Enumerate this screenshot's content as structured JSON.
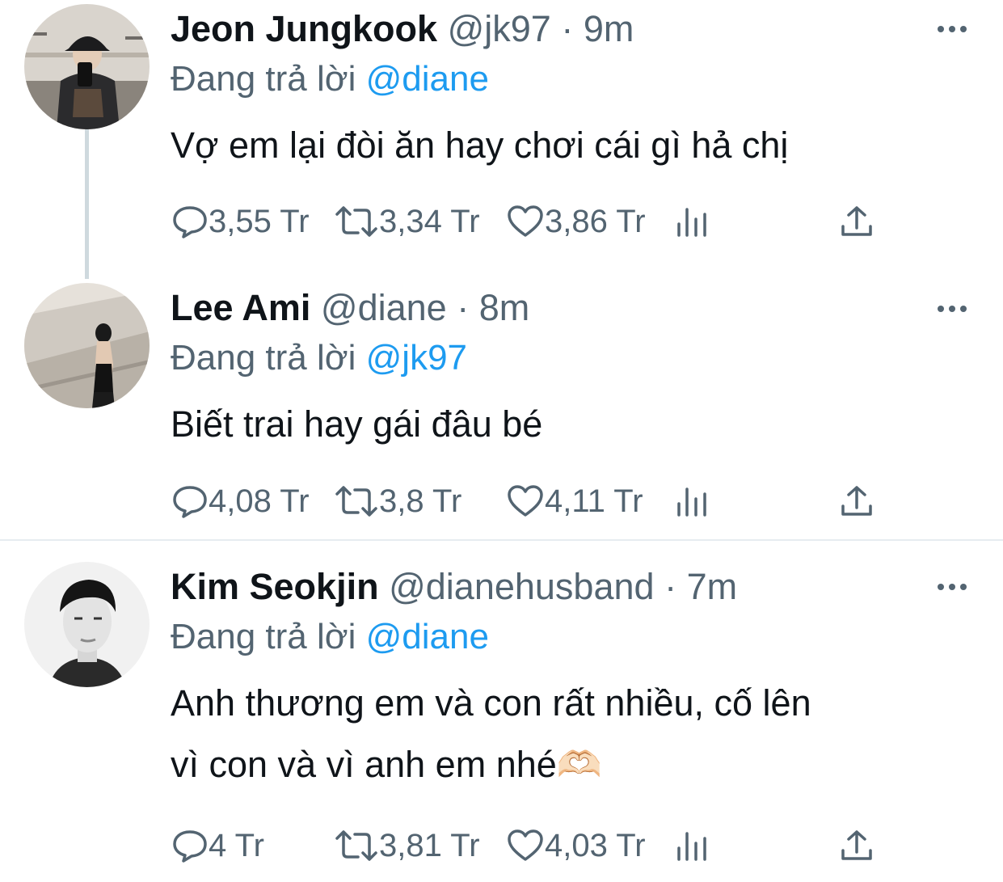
{
  "tweets": [
    {
      "name": "Jeon Jungkook",
      "handle": "@jk97",
      "dot": "·",
      "time": "9m",
      "reply_prefix": "Đang trả lời",
      "reply_to": "@diane",
      "text": "Vợ em lại đòi ăn hay chơi cái gì hả chị",
      "replies": "3,55 Tr",
      "retweets": "3,34 Tr",
      "likes": "3,86 Tr"
    },
    {
      "name": "Lee Ami",
      "handle": "@diane",
      "dot": "·",
      "time": "8m",
      "reply_prefix": "Đang trả lời",
      "reply_to": "@jk97",
      "text": "Biết trai hay gái đâu bé",
      "replies": "4,08 Tr",
      "retweets": "3,8 Tr",
      "likes": "4,11 Tr"
    },
    {
      "name": "Kim Seokjin",
      "handle": "@dianehusband",
      "dot": "·",
      "time": "7m",
      "reply_prefix": "Đang trả lời",
      "reply_to": "@diane",
      "text_line1": "Anh thương em và con rất nhiều, cố lên",
      "text_line2": "vì con và vì anh em nhé🫶🏻",
      "replies": "4 Tr",
      "retweets": "3,81 Tr",
      "likes": "4,03 Tr"
    }
  ],
  "icons": {
    "reply": "speech-bubble-icon",
    "retweet": "retweet-arrows-icon",
    "like": "heart-outline-icon",
    "views": "bar-chart-icon",
    "share": "share-upload-icon",
    "more": "more-dots-icon"
  },
  "colors": {
    "text_primary": "#0f1419",
    "text_secondary": "#536471",
    "mention_blue": "#1d9bf0",
    "thread_line": "#cfd9de",
    "divider": "#e6ecf0"
  }
}
